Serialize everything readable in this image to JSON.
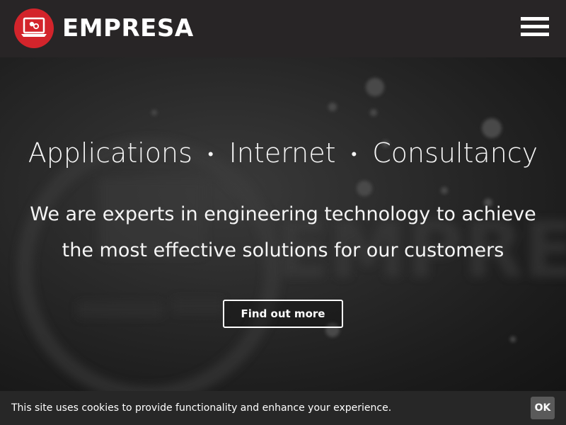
{
  "header": {
    "brand_name": "EMPRESA",
    "logo_icon": "laptop-logo-icon",
    "menu_icon": "hamburger-menu-icon"
  },
  "hero": {
    "title_parts": [
      "Applications",
      "•",
      "Internet",
      "•",
      "Consultancy"
    ],
    "line1": "We are experts in engineering technology to achieve",
    "line2": "the most effective solutions for our customers",
    "cta_label": "Find out more"
  },
  "cookie_bar": {
    "message": "This site uses cookies to provide functionality and enhance your experience.",
    "ok_label": "OK"
  },
  "colors": {
    "brand_red": "#d3242b",
    "header_bg": "#282526",
    "cookie_bg": "#272727",
    "ok_bg": "#5a5a5a"
  }
}
